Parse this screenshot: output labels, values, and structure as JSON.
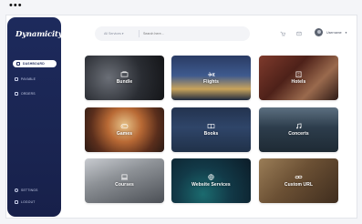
{
  "window": {
    "dots": "•••"
  },
  "sidebar": {
    "logo": "Dynamicity",
    "items": [
      {
        "label": "DASHBOARD",
        "active": true,
        "icon": "grid-icon"
      },
      {
        "label": "PAYABLE",
        "active": false,
        "icon": "wallet-icon"
      },
      {
        "label": "ORDERS",
        "active": false,
        "icon": "list-icon"
      }
    ],
    "bottom_items": [
      {
        "label": "SETTINGS",
        "icon": "gear-icon"
      },
      {
        "label": "LOGOUT",
        "icon": "logout-icon"
      }
    ]
  },
  "topbar": {
    "filter_value": "All Services",
    "search_placeholder": "Search here...",
    "icons": [
      "cart-icon",
      "message-icon"
    ],
    "user_name": "Username"
  },
  "cards": [
    {
      "label": "Bundle",
      "icon": "bundle-icon"
    },
    {
      "label": "Flights",
      "icon": "plane-icon"
    },
    {
      "label": "Hotels",
      "icon": "hotel-icon"
    },
    {
      "label": "Games",
      "icon": "gamepad-icon"
    },
    {
      "label": "Books",
      "icon": "book-icon"
    },
    {
      "label": "Concerts",
      "icon": "music-icon"
    },
    {
      "label": "Courses",
      "icon": "laptop-icon"
    },
    {
      "label": "Website Services",
      "icon": "globe-icon"
    },
    {
      "label": "Custom URL",
      "icon": "link-icon"
    }
  ],
  "colors": {
    "sidebar": "#1d2a5c",
    "accent_text": "#ffffff",
    "background": "#f4f5f8"
  }
}
